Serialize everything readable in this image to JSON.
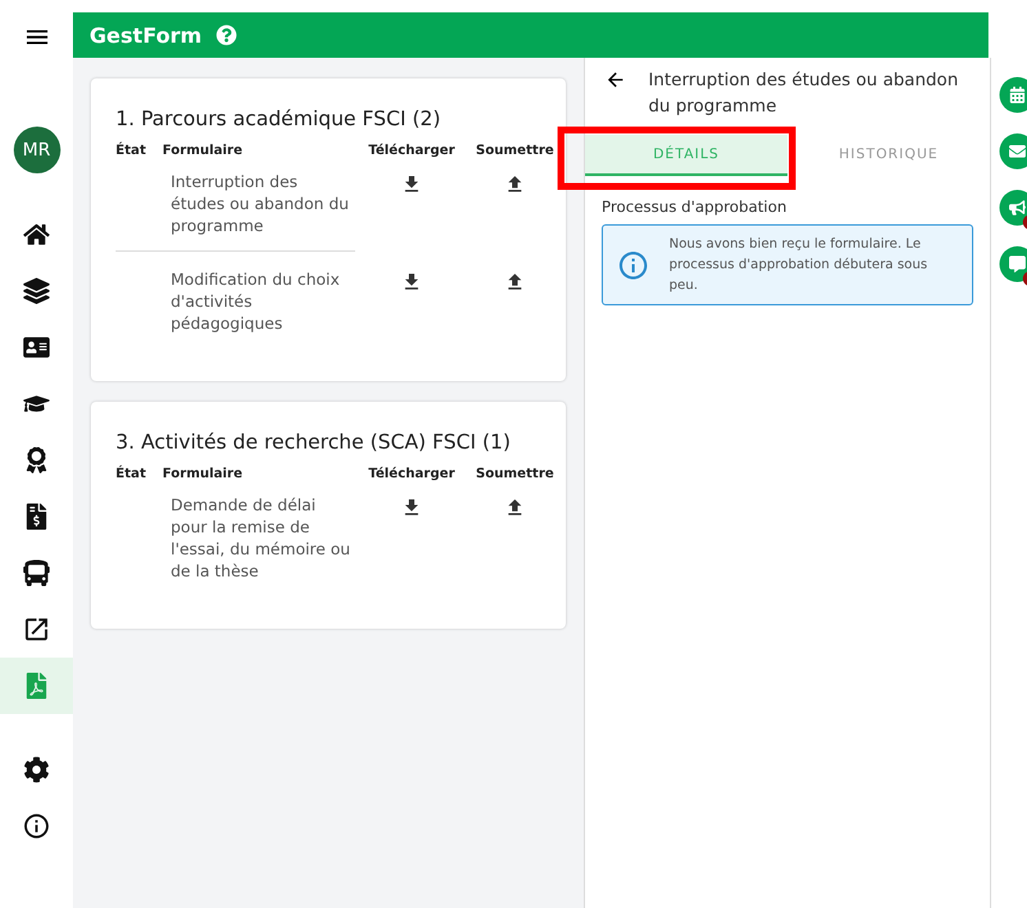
{
  "app": {
    "title": "GestForm"
  },
  "user": {
    "initials": "MR"
  },
  "nav": [
    {
      "selected": false
    },
    {
      "selected": false
    },
    {
      "selected": false
    },
    {
      "selected": false
    },
    {
      "selected": false
    },
    {
      "selected": false
    },
    {
      "selected": false
    },
    {
      "selected": false
    },
    {
      "selected": true
    }
  ],
  "nav_bottom": [
    {
      "selected": false
    },
    {
      "selected": false
    }
  ],
  "sections": [
    {
      "title": "1. Parcours académique FSCI (2)",
      "columns": [
        "État",
        "Formulaire",
        "Télécharger",
        "Soumettre"
      ],
      "rows": [
        {
          "form": "Interruption des études ou abandon du programme"
        },
        {
          "form": "Modification du choix d'activités pédagogiques"
        }
      ]
    },
    {
      "title": "3. Activités de recherche (SCA) FSCI (1)",
      "columns": [
        "État",
        "Formulaire",
        "Télécharger",
        "Soumettre"
      ],
      "rows": [
        {
          "form": "Demande de délai pour la remise de l'essai, du mémoire ou de la thèse"
        }
      ]
    }
  ],
  "detail": {
    "title": "Interruption des études ou abandon du programme",
    "tabs": [
      {
        "label": "DÉTAILS",
        "selected": true,
        "highlighted": true
      },
      {
        "label": "HISTORIQUE",
        "selected": false,
        "highlighted": false
      }
    ],
    "section_title": "Processus d'approbation",
    "message": "Nous avons bien reçu le formulaire. Le processus d'approbation débutera sous peu."
  },
  "quick_actions": [
    {
      "badge": false
    },
    {
      "badge": false
    },
    {
      "badge": true
    },
    {
      "badge": true
    }
  ]
}
